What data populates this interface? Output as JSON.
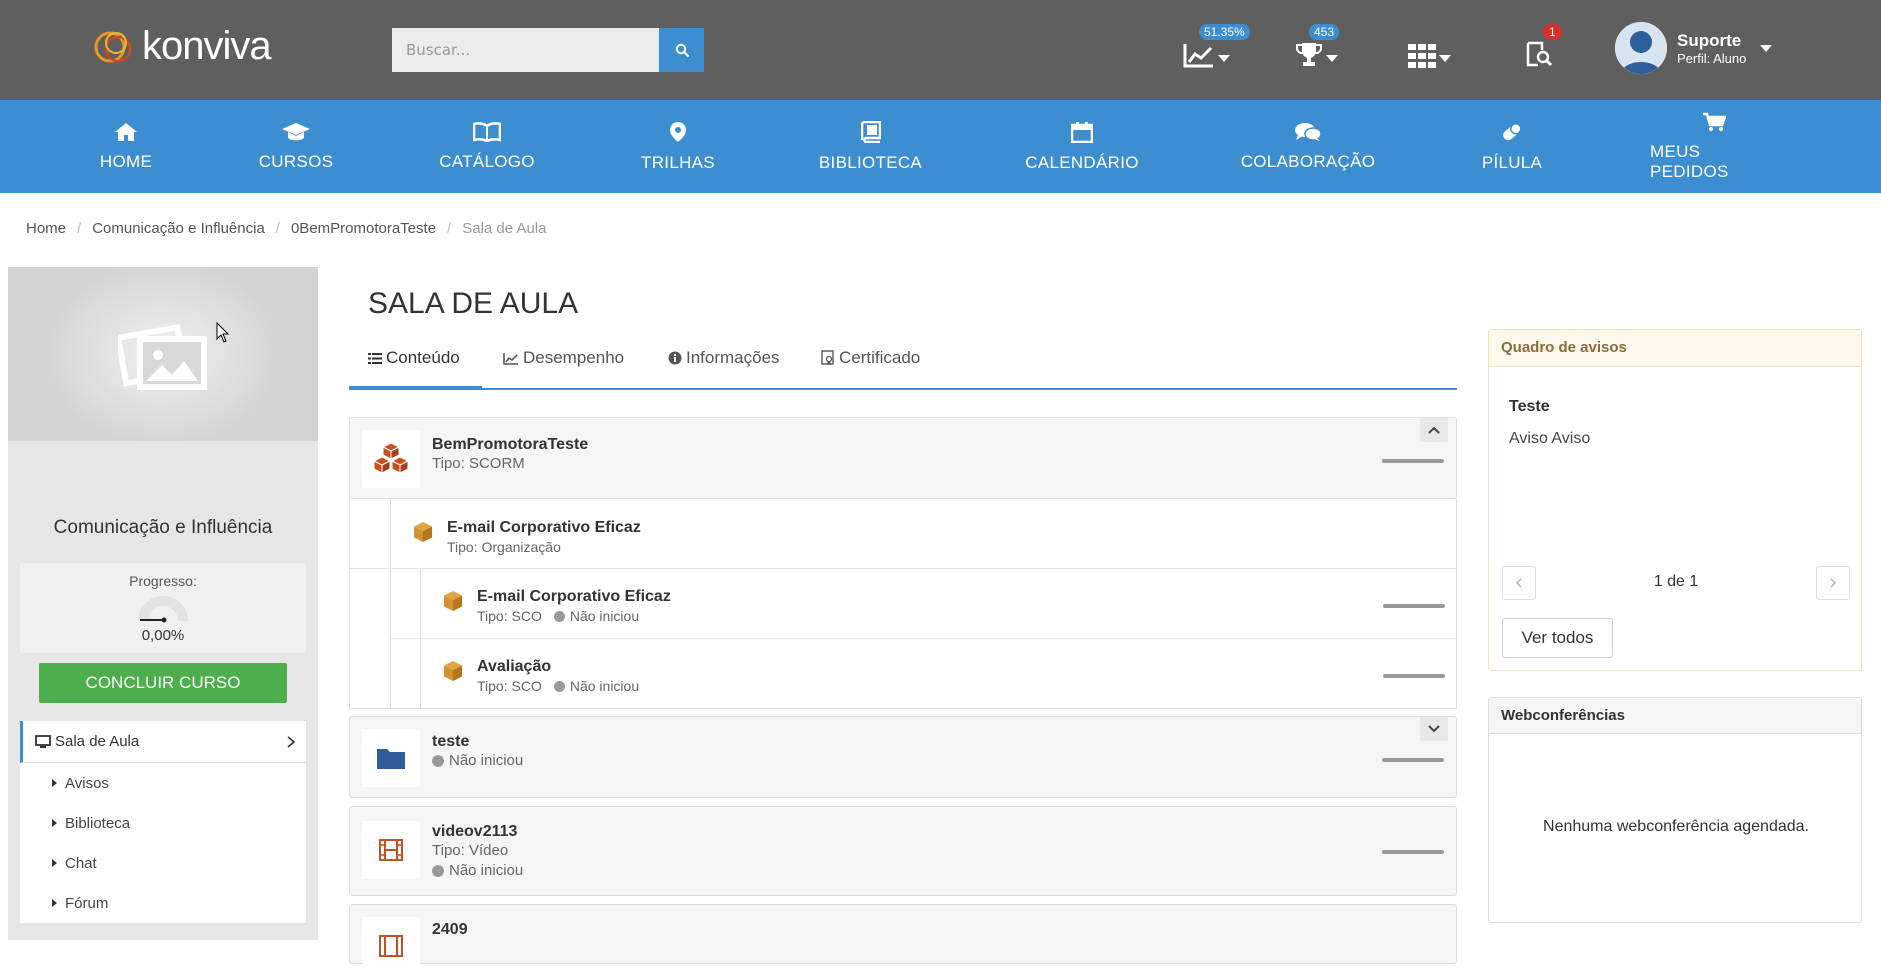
{
  "header": {
    "logo_text": "konviva",
    "search_placeholder": "Buscar...",
    "progress_badge": "51.35%",
    "trophy_badge": "453",
    "notif_badge": "1",
    "user": {
      "name": "Suporte",
      "role": "Perfil: Aluno"
    }
  },
  "nav": [
    {
      "label": "HOME",
      "icon": "home-icon"
    },
    {
      "label": "CURSOS",
      "icon": "graduation-cap-icon"
    },
    {
      "label": "CATÁLOGO",
      "icon": "open-book-icon"
    },
    {
      "label": "TRILHAS",
      "icon": "map-marker-icon"
    },
    {
      "label": "BIBLIOTECA",
      "icon": "book-icon"
    },
    {
      "label": "CALENDÁRIO",
      "icon": "calendar-icon"
    },
    {
      "label": "COLABORAÇÃO",
      "icon": "comments-icon"
    },
    {
      "label": "PÍLULA",
      "icon": "pill-icon"
    },
    {
      "label": "MEUS PEDIDOS",
      "icon": "cart-icon"
    }
  ],
  "breadcrumb": [
    "Home",
    "Comunicação e Influência",
    "0BemPromotoraTeste",
    "Sala de Aula"
  ],
  "sidebar": {
    "course_title": "Comunicação e Influência",
    "progress_label": "Progresso:",
    "progress_value": "0,00%",
    "progress_fraction": 0,
    "conclude_button": "CONCLUIR CURSO",
    "menu_head": "Sala de Aula",
    "menu_items": [
      "Avisos",
      "Biblioteca",
      "Chat",
      "Fórum"
    ]
  },
  "main": {
    "title": "SALA DE AULA",
    "tabs": [
      {
        "label": "Conteúdo",
        "icon": "list-icon"
      },
      {
        "label": "Desempenho",
        "icon": "line-chart-icon"
      },
      {
        "label": "Informações",
        "icon": "info-icon"
      },
      {
        "label": "Certificado",
        "icon": "certificate-icon"
      }
    ],
    "items": [
      {
        "title": "BemPromotoraTeste",
        "sub": "Tipo: SCORM"
      },
      {
        "title": "E-mail Corporativo Eficaz",
        "sub": "Tipo: Organização"
      },
      {
        "title": "E-mail Corporativo Eficaz",
        "sub": "Tipo: SCO",
        "status": "Não iniciou"
      },
      {
        "title": "Avaliação",
        "sub": "Tipo: SCO",
        "status": "Não iniciou"
      },
      {
        "title": "teste",
        "status": "Não iniciou"
      },
      {
        "title": "videov2113",
        "sub": "Tipo: Vídeo",
        "status": "Não iniciou"
      },
      {
        "title": "2409"
      }
    ]
  },
  "avisos": {
    "header": "Quadro de avisos",
    "title": "Teste",
    "text": "Aviso Aviso",
    "pagination": "1 de 1",
    "ver_todos": "Ver todos"
  },
  "webconf": {
    "header": "Webconferências",
    "empty": "Nenhuma webconferência agendada."
  },
  "colors": {
    "accent": "#3d8ed0",
    "topbar": "#5f5f5f",
    "success": "#4cae4c",
    "scorm_orange": "#c8501e",
    "folder_blue": "#2e5b9a"
  }
}
